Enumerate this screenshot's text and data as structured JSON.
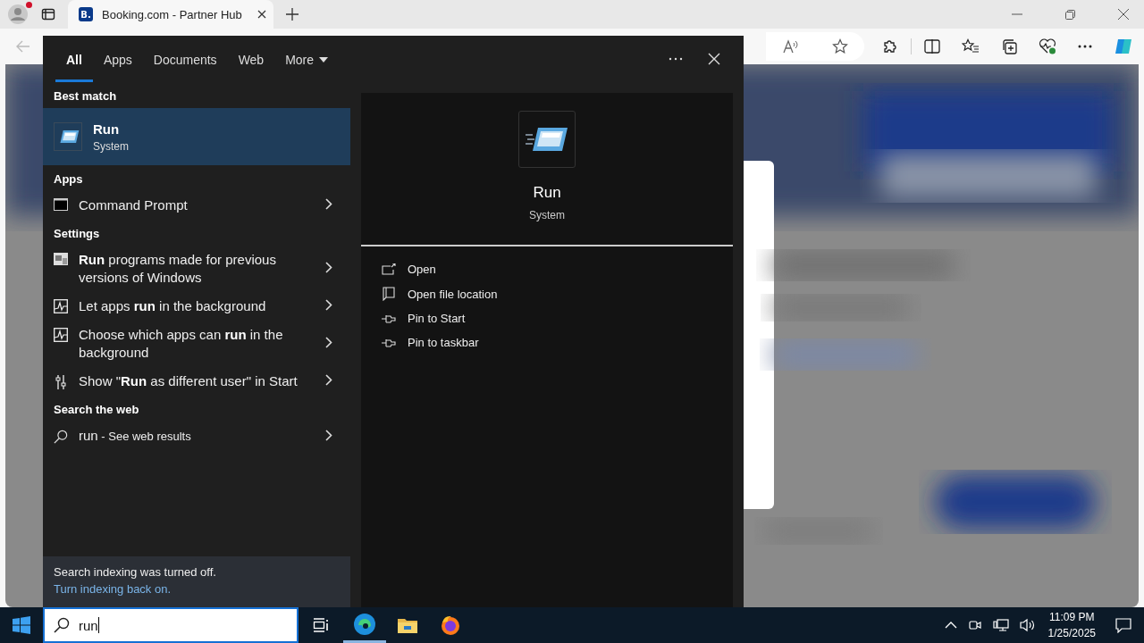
{
  "browser": {
    "tab": {
      "title": "Booking.com - Partner Hub",
      "favicon": "B.",
      "selected": true
    },
    "profile": {
      "notification": true
    }
  },
  "search_flyout": {
    "tabs": [
      {
        "label": "All",
        "selected": true
      },
      {
        "label": "Apps",
        "selected": false
      },
      {
        "label": "Documents",
        "selected": false
      },
      {
        "label": "Web",
        "selected": false
      },
      {
        "label": "More",
        "selected": false,
        "dropdown": true
      }
    ],
    "best_match": {
      "heading": "Best match",
      "title": "Run",
      "subtitle": "System",
      "selected": true
    },
    "sections": [
      {
        "heading": "Apps",
        "items": [
          {
            "kind": "console",
            "text": "Command Prompt"
          }
        ]
      },
      {
        "heading": "Settings",
        "items": [
          {
            "kind": "compat",
            "text": "**Run** programs made for previous versions of Windows"
          },
          {
            "kind": "activity",
            "text": "Let apps **run** in the background"
          },
          {
            "kind": "activity",
            "text": "Choose which apps can **run** in the background"
          },
          {
            "kind": "user",
            "text": "Show \"**Run** as different user\" in Start"
          }
        ]
      },
      {
        "heading": "Search the web",
        "items": [
          {
            "kind": "web",
            "text": "run",
            "suffix": "- See web results"
          }
        ]
      }
    ],
    "notice": {
      "text": "Search indexing was turned off.",
      "link": "Turn indexing back on."
    },
    "preview": {
      "title": "Run",
      "subtitle": "System",
      "actions": [
        {
          "kind": "open",
          "label": "Open"
        },
        {
          "kind": "folder",
          "label": "Open file location"
        },
        {
          "kind": "pin",
          "label": "Pin to Start"
        },
        {
          "kind": "pin",
          "label": "Pin to taskbar"
        }
      ]
    }
  },
  "taskbar": {
    "search": {
      "value": "run"
    },
    "time": "11:09 PM",
    "date": "1/25/2025"
  }
}
